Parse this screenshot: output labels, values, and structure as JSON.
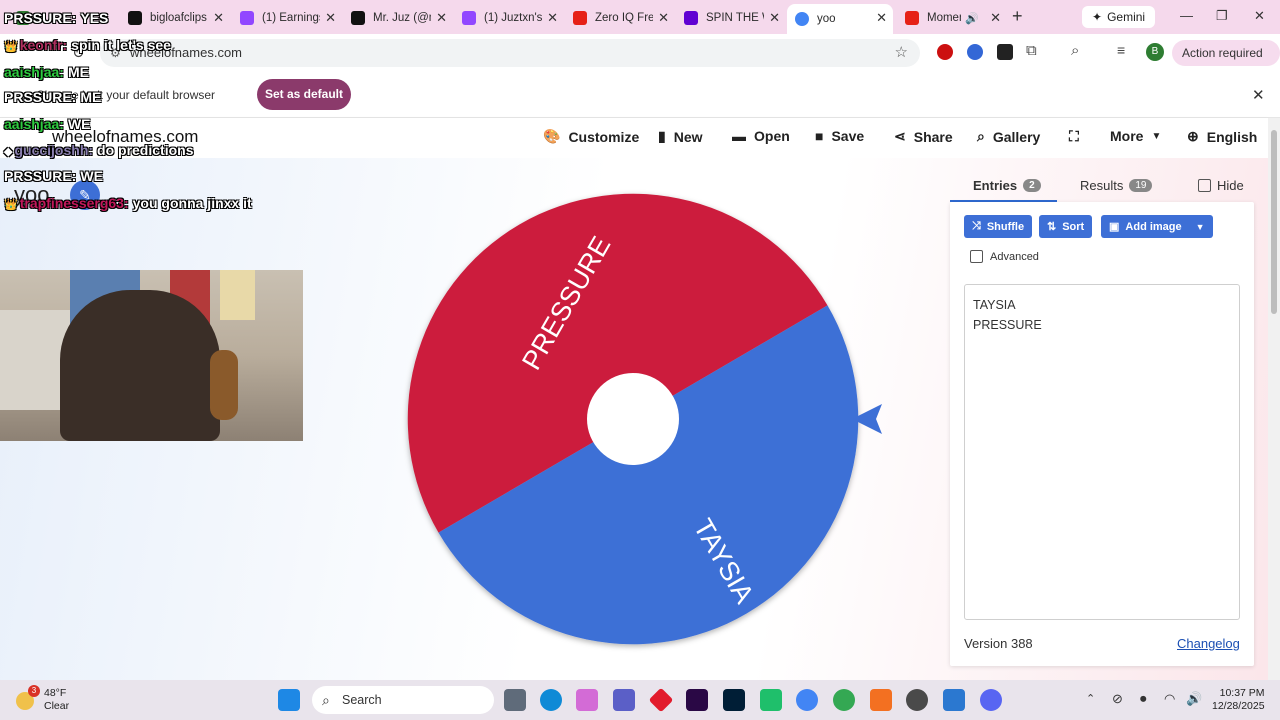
{
  "browser": {
    "tabs": [
      {
        "title": "",
        "favicon_color": "#2e7d32",
        "active": false
      },
      {
        "title": "bigloafclips",
        "favicon_color": "#111111",
        "active": false
      },
      {
        "title": "(1) Earnings",
        "favicon_color": "#9147ff",
        "active": false
      },
      {
        "title": "Mr. Juz (@m",
        "favicon_color": "#111111",
        "active": false
      },
      {
        "title": "(1) Juztxn's",
        "favicon_color": "#9147ff",
        "active": false
      },
      {
        "title": "Zero IQ Fre",
        "favicon_color": "#e62117",
        "active": false
      },
      {
        "title": "SPIN THE W",
        "favicon_color": "#6001d2",
        "active": false
      },
      {
        "title": "yoo",
        "favicon_color": "#4285f4",
        "active": true
      },
      {
        "title": "Momen",
        "favicon_color": "#e62117",
        "active": false
      }
    ],
    "gemini_label": "Gemini",
    "url": "wheelofnames.com",
    "action_required": "Action required",
    "profile_initial": "B"
  },
  "infobar": {
    "message": "Chrome isn't your default browser",
    "button": "Set as default"
  },
  "site": {
    "title": "wheelofnames.com",
    "menu": [
      {
        "label": "Customize",
        "icon": "palette-icon"
      },
      {
        "label": "New",
        "icon": "file-icon"
      },
      {
        "label": "Open",
        "icon": "folder-icon"
      },
      {
        "label": "Save",
        "icon": "floppy-icon"
      },
      {
        "label": "Share",
        "icon": "share-icon"
      },
      {
        "label": "Gallery",
        "icon": "search-icon"
      },
      {
        "label": "",
        "icon": "fullscreen-icon"
      },
      {
        "label": "More",
        "icon": "chevron-down-icon"
      },
      {
        "label": "English",
        "icon": "globe-icon"
      }
    ]
  },
  "wheel": {
    "title": "yoo",
    "slices": [
      {
        "label": "PRESSURE",
        "color": "#cc1e3c"
      },
      {
        "label": "TAYSIA",
        "color": "#3d6fd6"
      }
    ],
    "pointer_color": "#3d6fd6"
  },
  "panel": {
    "tab_entries": "Entries",
    "entries_count": "2",
    "tab_results": "Results",
    "results_count": "19",
    "hide_label": "Hide",
    "shuffle": "Shuffle",
    "sort": "Sort",
    "add_image": "Add image",
    "advanced": "Advanced",
    "entries": [
      "TAYSIA",
      "PRESSURE"
    ],
    "version": "Version 388",
    "changelog": "Changelog"
  },
  "chat": [
    {
      "user": "PRSSURE:",
      "msg": "YES",
      "color": "#ffffff"
    },
    {
      "user": "keonfr:",
      "msg": "spin it let's see",
      "color": "#b03060"
    },
    {
      "user": "aaishjaa:",
      "msg": "ME",
      "color": "#2ecc40"
    },
    {
      "user": "PRSSURE:",
      "msg": "ME",
      "color": "#ffffff"
    },
    {
      "user": "aaishjaa:",
      "msg": "WE",
      "color": "#2ecc40"
    },
    {
      "user": "guccijoshh:",
      "msg": "do predictions",
      "color": "#8a7fb0"
    },
    {
      "user": "PRSSURE:",
      "msg": "WE",
      "color": "#ffffff"
    },
    {
      "user": "trapfinesserg63:",
      "msg": "you gonna jinxx it",
      "color": "#c2185b"
    }
  ],
  "taskbar": {
    "weather_temp": "48°F",
    "weather_desc": "Clear",
    "weather_badge": "3",
    "search": "Search",
    "time": "10:37 PM",
    "date": "12/28/2025"
  }
}
